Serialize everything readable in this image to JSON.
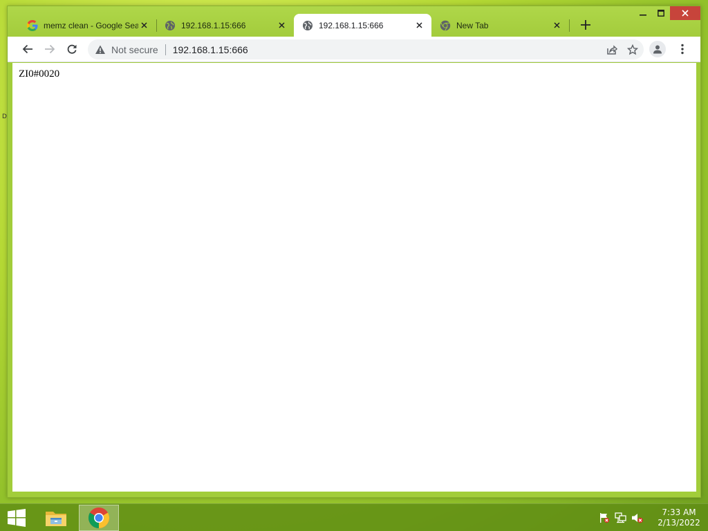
{
  "browser": {
    "tabs": [
      {
        "title": "memz clean - Google Search",
        "favicon": "google-g-icon",
        "active": false
      },
      {
        "title": "192.168.1.15:666",
        "favicon": "globe-icon",
        "active": false
      },
      {
        "title": "192.168.1.15:666",
        "favicon": "globe-icon",
        "active": true
      },
      {
        "title": "New Tab",
        "favicon": "chrome-icon",
        "active": false
      }
    ],
    "omnibox": {
      "security_label": "Not secure",
      "url": "192.168.1.15:666"
    }
  },
  "page": {
    "body_text": "ZI0#0020"
  },
  "taskbar": {
    "time": "7:33 AM",
    "date": "2/13/2022",
    "pinned": [
      "file-explorer-icon",
      "chrome-icon"
    ]
  },
  "colors": {
    "accent": "#a2cd3a",
    "close_button": "#c7443b",
    "taskbar": "#5f8c14"
  }
}
